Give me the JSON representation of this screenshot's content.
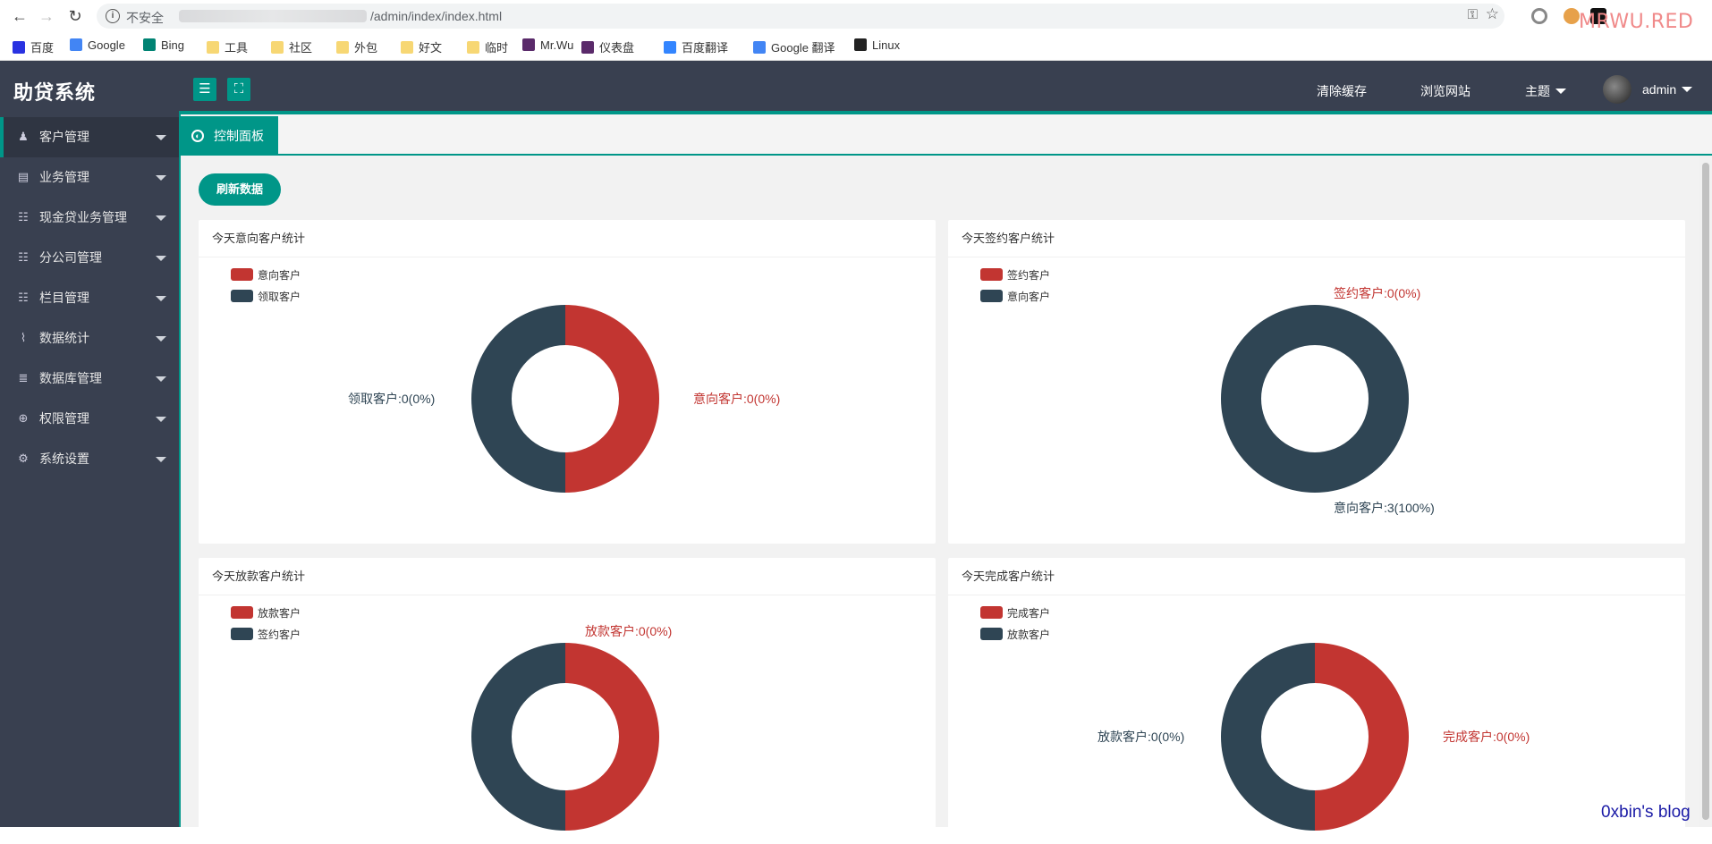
{
  "browser": {
    "insecure_label": "不安全",
    "url_path": "/admin/index/index.html",
    "watermark": "MRWU.RED"
  },
  "bookmarks": [
    {
      "label": "百度",
      "icon": "baidu-icon",
      "color": "#2932e1"
    },
    {
      "label": "Google",
      "icon": "google-icon",
      "color": "#4285f4"
    },
    {
      "label": "Bing",
      "icon": "bing-icon",
      "color": "#008373"
    },
    {
      "label": "工具",
      "icon": "folder-icon",
      "color": "#f7d774"
    },
    {
      "label": "社区",
      "icon": "folder-icon",
      "color": "#f7d774"
    },
    {
      "label": "外包",
      "icon": "folder-icon",
      "color": "#f7d774"
    },
    {
      "label": "好文",
      "icon": "folder-icon",
      "color": "#f7d774"
    },
    {
      "label": "临时",
      "icon": "folder-icon",
      "color": "#f7d774"
    },
    {
      "label": "Mr.Wu",
      "icon": "mrwu-icon",
      "color": "#5a2a6a"
    },
    {
      "label": "仪表盘",
      "icon": "dashboard-icon",
      "color": "#5a2a6a"
    },
    {
      "label": "百度翻译",
      "icon": "baidu-translate-icon",
      "color": "#3385ff"
    },
    {
      "label": "Google 翻译",
      "icon": "google-translate-icon",
      "color": "#4285f4"
    },
    {
      "label": "Linux",
      "icon": "bt-icon",
      "color": "#222222"
    }
  ],
  "app": {
    "title": "助贷系统",
    "topbar": {
      "clear_cache": "清除缓存",
      "browse_site": "浏览网站",
      "theme": "主题",
      "user": "admin"
    },
    "menu": [
      {
        "label": "客户管理",
        "icon": "user-icon"
      },
      {
        "label": "业务管理",
        "icon": "document-icon"
      },
      {
        "label": "现金贷业务管理",
        "icon": "list-icon"
      },
      {
        "label": "分公司管理",
        "icon": "list-icon"
      },
      {
        "label": "栏目管理",
        "icon": "list-icon"
      },
      {
        "label": "数据统计",
        "icon": "chart-icon"
      },
      {
        "label": "数据库管理",
        "icon": "database-icon"
      },
      {
        "label": "权限管理",
        "icon": "globe-icon"
      },
      {
        "label": "系统设置",
        "icon": "gear-icon"
      }
    ],
    "tab": "控制面板",
    "refresh_button": "刷新数据",
    "footer_watermark": "0xbin's blog"
  },
  "colors": {
    "red": "#c23531",
    "dark": "#2f4554",
    "accent": "#009688",
    "sidebar": "#394050"
  },
  "chart_data": [
    {
      "type": "pie",
      "title": "今天意向客户统计",
      "legend": [
        "意向客户",
        "领取客户"
      ],
      "values": [
        0,
        0
      ],
      "labels": [
        "意向客户:0(0%)",
        "领取客户:0(0%)"
      ]
    },
    {
      "type": "pie",
      "title": "今天签约客户统计",
      "legend": [
        "签约客户",
        "意向客户"
      ],
      "values": [
        0,
        3
      ],
      "labels": [
        "签约客户:0(0%)",
        "意向客户:3(100%)"
      ]
    },
    {
      "type": "pie",
      "title": "今天放款客户统计",
      "legend": [
        "放款客户",
        "签约客户"
      ],
      "values": [
        0,
        0
      ],
      "labels": [
        "放款客户:0(0%)"
      ]
    },
    {
      "type": "pie",
      "title": "今天完成客户统计",
      "legend": [
        "完成客户",
        "放款客户"
      ],
      "values": [
        0,
        0
      ],
      "labels": [
        "完成客户:0(0%)",
        "放款客户:0(0%)"
      ]
    }
  ]
}
